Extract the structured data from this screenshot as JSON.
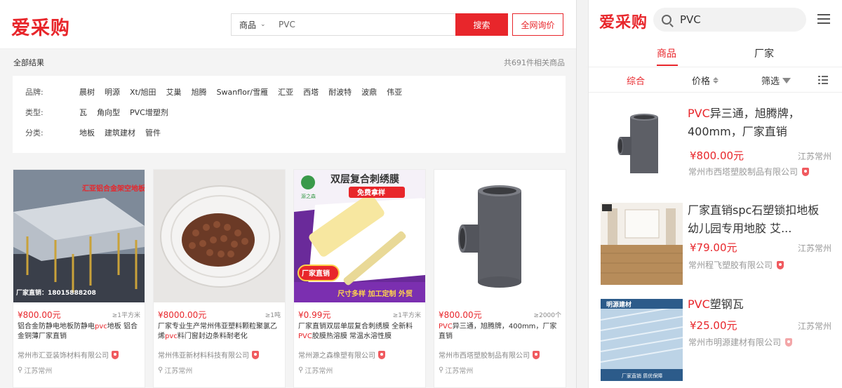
{
  "desktop": {
    "logo": "爱采购",
    "search": {
      "category": "商品",
      "query": "PVC",
      "button": "搜索",
      "inquiry": "全网询价"
    },
    "results_label": "全部结果",
    "results_count": "共691件相关商品",
    "filters": [
      {
        "label": "品牌:",
        "items": [
          "晨树",
          "明源",
          "Xt/旭田",
          "艾巢",
          "旭腾",
          "Swanflor/雪雁",
          "汇亚",
          "西塔",
          "耐波特",
          "波鼎",
          "伟亚"
        ]
      },
      {
        "label": "类型:",
        "items": [
          "瓦",
          "角向型",
          "PVC增塑剂"
        ]
      },
      {
        "label": "分类:",
        "items": [
          "地板",
          "建筑建材",
          "管件"
        ]
      }
    ],
    "products": [
      {
        "price": "¥800.00元",
        "unit": "≥1平方米",
        "title_pre": "铝合金防静电地板防静电",
        "title_hl": "pvc",
        "title_post": "地板 铝合金铜薄厂家直销",
        "company": "常州市汇亚装饰材料有限公司",
        "location": "江苏常州",
        "img_caption": "汇亚铝合金架空地板",
        "img_phone": "厂家直销：18015888208"
      },
      {
        "price": "¥8000.00元",
        "unit": "≥1吨",
        "title_pre": "厂家专业生产常州伟亚塑料颗粒聚氯乙烯",
        "title_hl": "pvc",
        "title_post": "料门窗封边条料耐老化",
        "company": "常州伟亚新材料科技有限公司",
        "location": "江苏常州"
      },
      {
        "price": "¥0.99元",
        "unit": "≥1平方米",
        "title_pre": "厂家直销双层单层复合刺绣膜 全新料",
        "title_hl": "PVC",
        "title_post": "胶膜热溶膜 常温水溶性膜",
        "company": "常州源之森橡塑有限公司",
        "location": "江苏常州",
        "img_brand": "源之森",
        "img_headline": "双层复合刺绣膜",
        "img_free": "免费拿样",
        "img_badge": "厂家直销",
        "img_bottom": "尺寸多样 加工定制 外贸"
      },
      {
        "price": "¥800.00元",
        "unit": "≥2000个",
        "title_pre": "",
        "title_hl": "PVC",
        "title_post": "异三通，旭腾牌，400mm，厂家直销",
        "company": "常州市西塔塑胶制品有限公司",
        "location": "江苏常州"
      }
    ]
  },
  "mobile": {
    "logo": "爱采购",
    "query": "PVC",
    "tabs": [
      "商品",
      "厂家"
    ],
    "sort": {
      "general": "综合",
      "price": "价格",
      "filter": "筛选"
    },
    "items": [
      {
        "title_hl": "PVC",
        "title_post": "异三通，旭腾牌，400mm，厂家直销",
        "price": "¥800.00元",
        "location": "江苏常州",
        "company": "常州市西塔塑胶制品有限公司"
      },
      {
        "title_hl": "",
        "title_post": "厂家直销spc石塑锁扣地板 幼儿园专用地胶 艾...",
        "price": "¥79.00元",
        "location": "江苏常州",
        "company": "常州程飞塑胶有限公司"
      },
      {
        "title_hl": "PVC",
        "title_post": "塑钢瓦",
        "price": "¥25.00元",
        "location": "江苏常州",
        "company": "常州市明源建材有限公司",
        "img_label": "明源建材",
        "img_bottom": "厂家直销  质优保障"
      }
    ],
    "colors": {
      "accent": "#e8262b"
    }
  }
}
